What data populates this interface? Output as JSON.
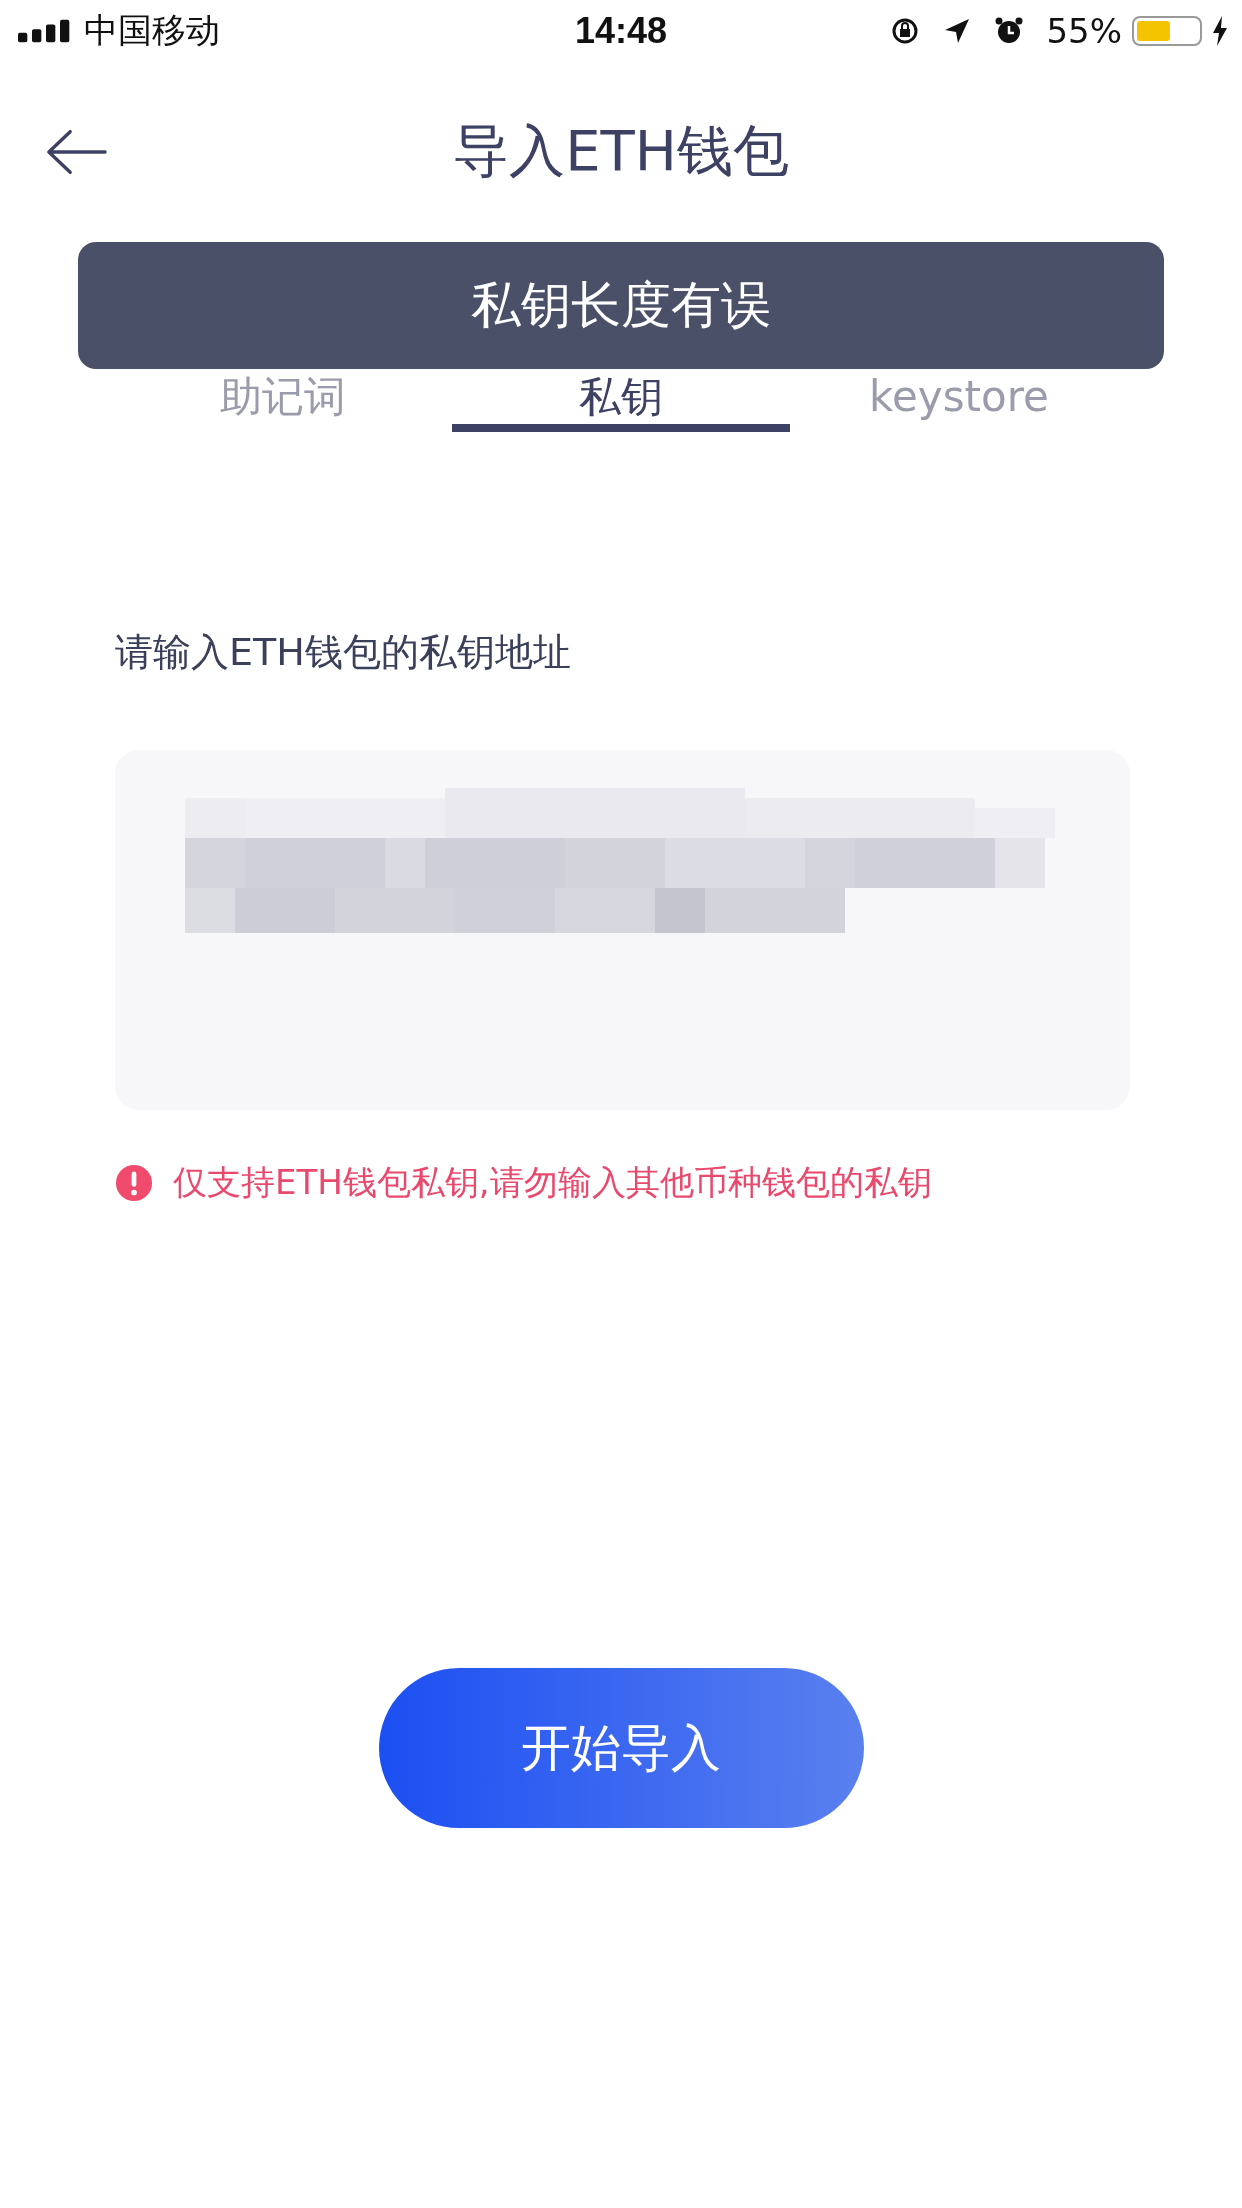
{
  "status_bar": {
    "carrier": "中国移动",
    "time": "14:48",
    "battery_percent": "55%",
    "charging": true
  },
  "header": {
    "title": "导入ETH钱包"
  },
  "toast": {
    "message": "私钥长度有误"
  },
  "tabs": [
    {
      "label": "助记词",
      "selected": false
    },
    {
      "label": "私钥",
      "selected": true
    },
    {
      "label": "keystore",
      "selected": false
    }
  ],
  "form": {
    "label": "请输入ETH钱包的私钥地址",
    "value_redacted": true,
    "warning": "仅支持ETH钱包私钥,请勿输入其他币种钱包的私钥"
  },
  "buttons": [
    {
      "label": "开始导入"
    }
  ]
}
